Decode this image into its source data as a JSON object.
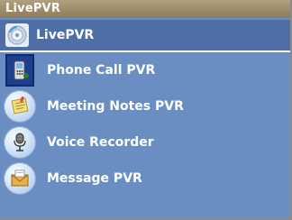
{
  "window": {
    "title": "LivePVR"
  },
  "header": {
    "title": "LivePVR",
    "icon": "livepvr-disc-icon"
  },
  "menu": {
    "items": [
      {
        "label": "Phone Call PVR",
        "icon": "phone-icon",
        "selected": true
      },
      {
        "label": "Meeting Notes PVR",
        "icon": "notes-icon",
        "selected": false
      },
      {
        "label": "Voice Recorder",
        "icon": "microphone-icon",
        "selected": false
      },
      {
        "label": "Message PVR",
        "icon": "mail-icon",
        "selected": false
      }
    ]
  },
  "colors": {
    "background": "#6a8ec2",
    "header_bar": "#4e6ea6",
    "title_bar": "#9c8a66",
    "text": "#ffffff"
  }
}
